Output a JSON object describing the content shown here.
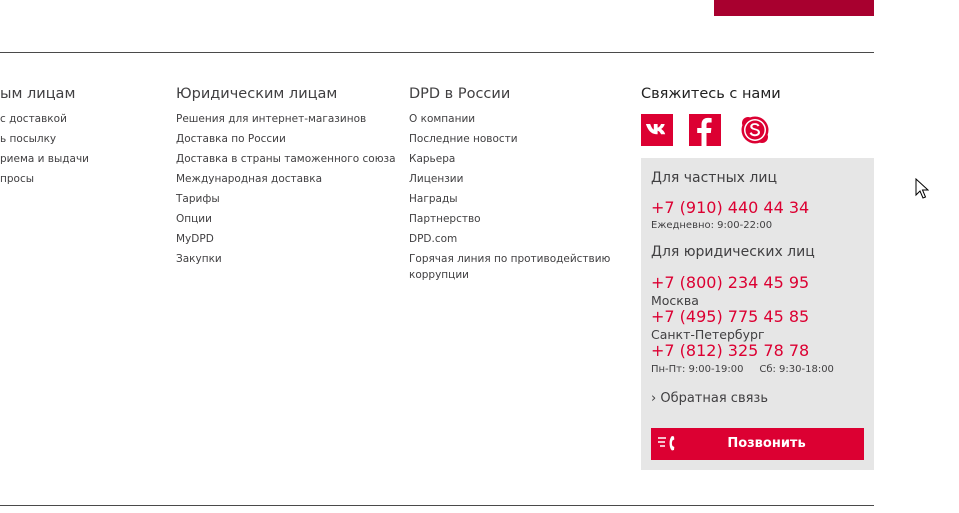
{
  "footer": {
    "columns": [
      {
        "title": "ым лицам",
        "links": [
          "с доставкой",
          "ь посылку",
          "риема и выдачи",
          "просы"
        ]
      },
      {
        "title": "Юридическим лицам",
        "links": [
          "Решения для интернет-магазинов",
          "Доставка по России",
          "Доставка в страны таможенного союза",
          "Международная доставка",
          "Тарифы",
          "Опции",
          "MyDPD",
          "Закупки"
        ]
      },
      {
        "title": "DPD в России",
        "links": [
          "О компании",
          "Последние новости",
          "Карьера",
          "Лицензии",
          "Награды",
          "Партнерство",
          "DPD.com",
          "Горячая линия по противодействию коррупции"
        ]
      }
    ],
    "contacts": {
      "title": "Свяжитесь с нами",
      "socials": [
        "vk-icon",
        "facebook-icon",
        "skype-icon"
      ],
      "private_label": "Для частных лиц",
      "private_phone": "+7 (910) 440 44 34",
      "private_hours": "Ежедневно: 9:00-22:00",
      "business_label": "Для юридических лиц",
      "business_phone": "+7 (800) 234 45 95",
      "moscow_label": "Москва",
      "moscow_phone": "+7 (495) 775 45 85",
      "spb_label": "Санкт-Петербург",
      "spb_phone": "+7 (812) 325 78 78",
      "business_hours": "Пн-Пт: 9:00-19:00     Сб: 9:30-18:00",
      "feedback_link": "› Обратная связь",
      "call_button": "Позвонить"
    }
  },
  "colors": {
    "accent": "#dc0032",
    "top_bar": "#a8002f",
    "card_bg": "#e6e6e6",
    "text": "#414042"
  }
}
